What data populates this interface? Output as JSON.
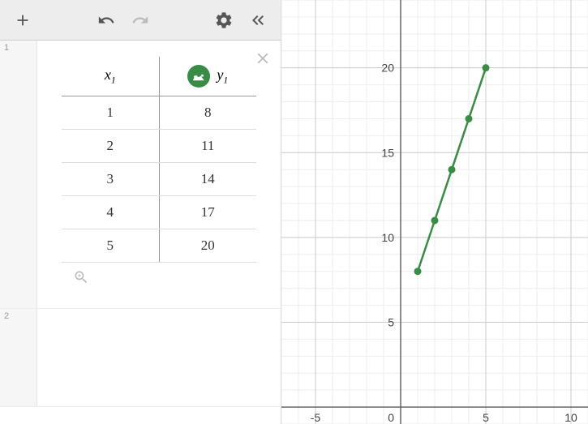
{
  "toolbar": {
    "add_icon": "add",
    "undo_icon": "undo",
    "redo_icon": "redo",
    "settings_icon": "settings",
    "collapse_icon": "collapse"
  },
  "rows": {
    "r1_index": "1",
    "r2_index": "2"
  },
  "table": {
    "x_header": "x",
    "x_sub": "1",
    "y_header": "y",
    "y_sub": "1",
    "rows": [
      {
        "x": "1",
        "y": "8"
      },
      {
        "x": "2",
        "y": "11"
      },
      {
        "x": "3",
        "y": "14"
      },
      {
        "x": "4",
        "y": "17"
      },
      {
        "x": "5",
        "y": "20"
      }
    ]
  },
  "axes": {
    "x_ticks": {
      "neg5": "-5",
      "zero": "0",
      "pos5": "5",
      "pos10": "10"
    },
    "y_ticks": {
      "y5": "5",
      "y10": "10",
      "y15": "15",
      "y20": "20"
    }
  },
  "colors": {
    "accent": "#388c46"
  },
  "chart_data": {
    "type": "line",
    "x": [
      1,
      2,
      3,
      4,
      5
    ],
    "y": [
      8,
      11,
      14,
      17,
      20
    ],
    "series": [
      {
        "name": "y1",
        "values": [
          8,
          11,
          14,
          17,
          20
        ]
      }
    ],
    "categories": [
      1,
      2,
      3,
      4,
      5
    ],
    "xlabel": "",
    "ylabel": "",
    "title": "",
    "xlim": [
      -7,
      11
    ],
    "ylim": [
      -1,
      24
    ],
    "x_ticks": [
      -5,
      0,
      5,
      10
    ],
    "y_ticks": [
      5,
      10,
      15,
      20
    ]
  }
}
